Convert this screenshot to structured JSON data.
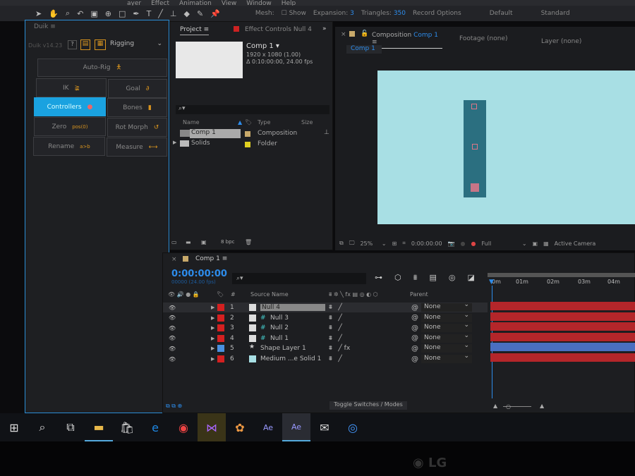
{
  "menu": [
    "ayer",
    "Effect",
    "Animation",
    "View",
    "Window",
    "Help"
  ],
  "toolbar": {
    "mesh_label": "Mesh:",
    "show_label": "Show",
    "expansion_label": "Expansion:",
    "expansion_value": "3",
    "triangles_label": "Triangles:",
    "triangles_value": "350",
    "record_options": "Record Options",
    "workspace_default": "Default",
    "workspace_standard": "Standard"
  },
  "duik": {
    "title": "Duik",
    "version": "Duik v14.23",
    "help": "?",
    "mode": "Rigging",
    "buttons": {
      "autorig": "Auto-Rig",
      "ik": "IK",
      "goal": "Goal",
      "controllers": "Controllers",
      "bones": "Bones",
      "zero": "Zero",
      "zero_icon": "pos(0)",
      "rotmorph": "Rot Morph",
      "rename": "Rename",
      "rename_icon": "a>b",
      "measure": "Measure"
    }
  },
  "project": {
    "tab": "Project",
    "effect_tab": "Effect Controls Null 4",
    "comp_name": "Comp 1",
    "resolution": "1920 x 1080 (1.00)",
    "duration": "Δ 0:10:00:00, 24.00 fps",
    "columns": {
      "name": "Name",
      "type": "Type",
      "size": "Size"
    },
    "items": [
      {
        "name": "Comp 1",
        "type": "Composition",
        "color": "#c8a96a"
      },
      {
        "name": "Solids",
        "type": "Folder",
        "color": "#e0d020"
      }
    ],
    "bpc": "8 bpc"
  },
  "composition": {
    "tab_prefix": "Composition",
    "tab_name": "Comp 1",
    "footage": "Footage (none)",
    "layer": "Layer (none)",
    "breadcrumb": "Comp 1",
    "zoom": "25%",
    "timecode": "0:00:00:00",
    "resolution": "Full",
    "camera": "Active Camera"
  },
  "timeline": {
    "tab": "Comp 1",
    "timecode": "0:00:00:00",
    "frames": "00000 (24.00 fps)",
    "columns": {
      "num": "#",
      "source": "Source Name",
      "parent": "Parent"
    },
    "ruler": [
      "0m",
      "01m",
      "02m",
      "03m",
      "04m"
    ],
    "toggle": "Toggle Switches / Modes",
    "layers": [
      {
        "num": "1",
        "name": "Null 4",
        "label": "#d42020",
        "fx": ""
      },
      {
        "num": "2",
        "name": "Null 3",
        "label": "#d42020",
        "fx": ""
      },
      {
        "num": "3",
        "name": "Null 2",
        "label": "#d42020",
        "fx": ""
      },
      {
        "num": "4",
        "name": "Null 1",
        "label": "#d42020",
        "fx": ""
      },
      {
        "num": "5",
        "name": "Shape Layer 1",
        "label": "#4a90e0",
        "fx": "fx"
      },
      {
        "num": "6",
        "name": "Medium ...e Solid 1",
        "label": "#d42020",
        "fx": ""
      }
    ],
    "parent_value": "None"
  },
  "brand": "LG"
}
